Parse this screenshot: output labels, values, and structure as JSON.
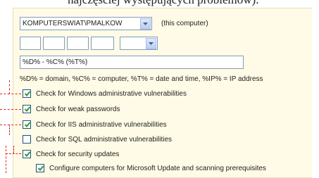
{
  "caption": "najczęściej występujących problemów):",
  "computer_select": {
    "value": "KOMPUTERSWIAT\\PMALKOW",
    "note": "(this computer)"
  },
  "name_pattern": {
    "value": "%D% - %C% (%T%)"
  },
  "legend": "%D% = domain, %C% = computer, %T% = date and time, %IP% = IP address",
  "options": [
    {
      "label": "Check for Windows administrative vulnerabilities",
      "checked": true
    },
    {
      "label": "Check for weak passwords",
      "checked": true
    },
    {
      "label": "Check for IIS administrative vulnerabilities",
      "checked": true
    },
    {
      "label": "Check for SQL administrative vulnerabilities",
      "checked": false
    },
    {
      "label": "Check for security updates",
      "checked": true
    }
  ],
  "sub_option": {
    "label": "Configure computers for Microsoft Update and scanning prerequisites",
    "checked": true
  },
  "colors": {
    "panel_bg": "#fffbe6",
    "callout": "#e0251b",
    "checkmark": "#2f9a2f"
  },
  "icons": {
    "dropdown": "chevron-down-icon",
    "checkbox": "checkbox-icon"
  }
}
